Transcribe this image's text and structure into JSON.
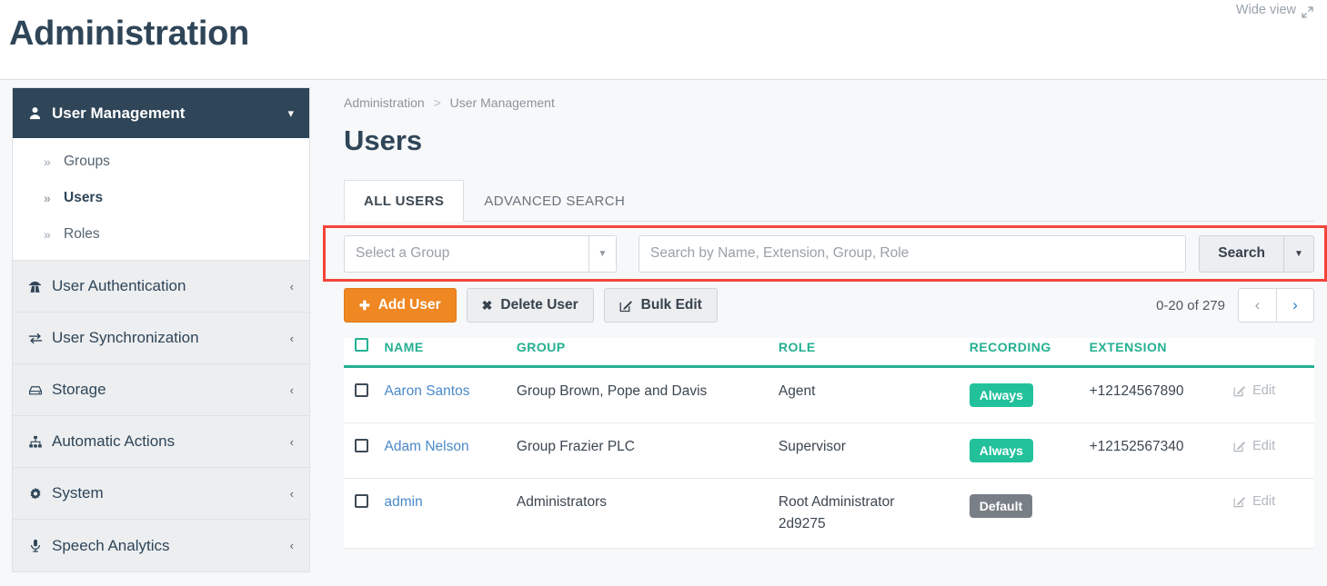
{
  "header": {
    "title": "Administration",
    "wide_view_label": "Wide view",
    "wide_view_icon": "expand-arrows-icon"
  },
  "sidebar": {
    "active_group": {
      "label": "User Management",
      "icon": "user-icon",
      "caret": "chevron-down-icon",
      "sub_items": [
        {
          "label": "Groups",
          "active": false,
          "marker": "»"
        },
        {
          "label": "Users",
          "active": true,
          "marker": "»"
        },
        {
          "label": "Roles",
          "active": false,
          "marker": "»"
        }
      ]
    },
    "items": [
      {
        "label": "User Authentication",
        "icon": "user-secret-icon",
        "caret": "chevron-left-icon"
      },
      {
        "label": "User Synchronization",
        "icon": "exchange-arrows-icon",
        "caret": "chevron-left-icon"
      },
      {
        "label": "Storage",
        "icon": "hard-drive-icon",
        "caret": "chevron-left-icon"
      },
      {
        "label": "Automatic Actions",
        "icon": "sitemap-icon",
        "caret": "chevron-left-icon"
      },
      {
        "label": "System",
        "icon": "gear-icon",
        "caret": "chevron-left-icon"
      },
      {
        "label": "Speech Analytics",
        "icon": "microphone-icon",
        "caret": "chevron-left-icon"
      }
    ]
  },
  "content": {
    "breadcrumb": {
      "root": "Administration",
      "separator": ">",
      "current": "User Management"
    },
    "page_title": "Users",
    "tabs": [
      {
        "label": "ALL USERS",
        "active": true
      },
      {
        "label": "ADVANCED SEARCH",
        "active": false
      }
    ],
    "search": {
      "group_select_placeholder": "Select a Group",
      "group_select_caret": "caret-down-icon",
      "search_placeholder": "Search by Name, Extension, Group, Role",
      "search_value": "",
      "search_button_label": "Search",
      "search_button_caret": "caret-down-icon",
      "highlight_color": "#f4443a"
    },
    "actions": [
      {
        "label": "Add User",
        "icon": "plus-icon",
        "style": "primary"
      },
      {
        "label": "Delete User",
        "icon": "times-icon",
        "style": "default"
      },
      {
        "label": "Bulk Edit",
        "icon": "pencil-square-icon",
        "style": "default"
      }
    ],
    "pagination": {
      "range_label": "0-20 of 279",
      "prev_icon": "chevron-left-icon",
      "next_icon": "chevron-right-icon"
    },
    "table": {
      "columns": [
        "",
        "NAME",
        "GROUP",
        "ROLE",
        "RECORDING",
        "EXTENSION",
        ""
      ],
      "edit_label": "Edit",
      "edit_icon": "pencil-square-icon",
      "rows": [
        {
          "name": "Aaron Santos",
          "group": "Group Brown, Pope and Davis",
          "role": "Agent",
          "role_line2": "",
          "recording": "Always",
          "recording_style": "always",
          "extension": "+12124567890"
        },
        {
          "name": "Adam Nelson",
          "group": "Group Frazier PLC",
          "role": "Supervisor",
          "role_line2": "",
          "recording": "Always",
          "recording_style": "always",
          "extension": "+12152567340"
        },
        {
          "name": "admin",
          "group": "Administrators",
          "role": "Root Administrator",
          "role_line2": "2d9275",
          "recording": "Default",
          "recording_style": "default",
          "extension": ""
        }
      ]
    }
  },
  "colors": {
    "navy": "#2f4558",
    "teal": "#24b092",
    "badge_teal": "#22c19b",
    "badge_gray": "#797f86",
    "orange": "#ef8722",
    "link_blue": "#4a89c9",
    "highlight_red": "#f4443a"
  }
}
